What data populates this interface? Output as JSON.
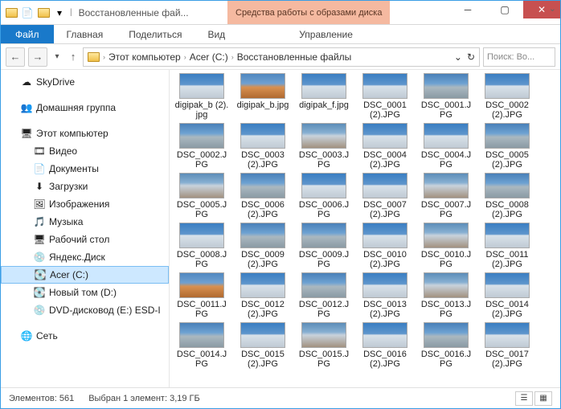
{
  "titlebar": {
    "qa_down": "▾",
    "qa_sep": "|",
    "title": "Восстановленные фай...",
    "contextual": "Средства работы с образами диска"
  },
  "win": {
    "min": "─",
    "max": "▢",
    "close": "✕"
  },
  "ribbon": {
    "file": "Файл",
    "home": "Главная",
    "share": "Поделиться",
    "view": "Вид",
    "manage": "Управление",
    "expand": "⌄"
  },
  "nav": {
    "back": "←",
    "fwd": "→",
    "dd": "▾",
    "up": "↑",
    "refresh": "↻",
    "addr_dd": "⌄",
    "seg1": "Этот компьютер",
    "seg2": "Acer (C:)",
    "seg3": "Восстановленные файлы",
    "sep": "›",
    "search_ph": "Поиск: Во..."
  },
  "sidebar": {
    "skydrive": "SkyDrive",
    "homegroup": "Домашняя группа",
    "thispc": "Этот компьютер",
    "video": "Видео",
    "documents": "Документы",
    "downloads": "Загрузки",
    "pictures": "Изображения",
    "music": "Музыка",
    "desktop": "Рабочий стол",
    "yadisk": "Яндекс.Диск",
    "acer": "Acer (C:)",
    "newvol": "Новый том (D:)",
    "dvd": "DVD-дисковод (E:) ESD-I",
    "network": "Сеть"
  },
  "files": [
    {
      "name": "digipak_b (2).jpg",
      "v": ""
    },
    {
      "name": "digipak_b.jpg",
      "v": "orange"
    },
    {
      "name": "digipak_f.jpg",
      "v": ""
    },
    {
      "name": "DSC_0001 (2).JPG",
      "v": ""
    },
    {
      "name": "DSC_0001.JPG",
      "v": "variant2"
    },
    {
      "name": "DSC_0002 (2).JPG",
      "v": ""
    },
    {
      "name": "DSC_0002.JPG",
      "v": "variant2"
    },
    {
      "name": "DSC_0003 (2).JPG",
      "v": ""
    },
    {
      "name": "DSC_0003.JPG",
      "v": "variant3"
    },
    {
      "name": "DSC_0004 (2).JPG",
      "v": ""
    },
    {
      "name": "DSC_0004.JPG",
      "v": ""
    },
    {
      "name": "DSC_0005 (2).JPG",
      "v": "variant2"
    },
    {
      "name": "DSC_0005.JPG",
      "v": "variant3"
    },
    {
      "name": "DSC_0006 (2).JPG",
      "v": "variant2"
    },
    {
      "name": "DSC_0006.JPG",
      "v": ""
    },
    {
      "name": "DSC_0007 (2).JPG",
      "v": ""
    },
    {
      "name": "DSC_0007.JPG",
      "v": "variant3"
    },
    {
      "name": "DSC_0008 (2).JPG",
      "v": "variant2"
    },
    {
      "name": "DSC_0008.JPG",
      "v": ""
    },
    {
      "name": "DSC_0009 (2).JPG",
      "v": "variant2"
    },
    {
      "name": "DSC_0009.JPG",
      "v": "variant2"
    },
    {
      "name": "DSC_0010 (2).JPG",
      "v": ""
    },
    {
      "name": "DSC_0010.JPG",
      "v": "variant3"
    },
    {
      "name": "DSC_0011 (2).JPG",
      "v": ""
    },
    {
      "name": "DSC_0011.JPG",
      "v": "orange"
    },
    {
      "name": "DSC_0012 (2).JPG",
      "v": ""
    },
    {
      "name": "DSC_0012.JPG",
      "v": "variant2"
    },
    {
      "name": "DSC_0013 (2).JPG",
      "v": ""
    },
    {
      "name": "DSC_0013.JPG",
      "v": "variant3"
    },
    {
      "name": "DSC_0014 (2).JPG",
      "v": ""
    },
    {
      "name": "DSC_0014.JPG",
      "v": "variant2"
    },
    {
      "name": "DSC_0015 (2).JPG",
      "v": ""
    },
    {
      "name": "DSC_0015.JPG",
      "v": "variant3"
    },
    {
      "name": "DSC_0016 (2).JPG",
      "v": ""
    },
    {
      "name": "DSC_0016.JPG",
      "v": "variant2"
    },
    {
      "name": "DSC_0017 (2).JPG",
      "v": ""
    }
  ],
  "status": {
    "count_label": "Элементов:",
    "count": "561",
    "selected": "Выбран 1 элемент: 3,19 ГБ"
  }
}
